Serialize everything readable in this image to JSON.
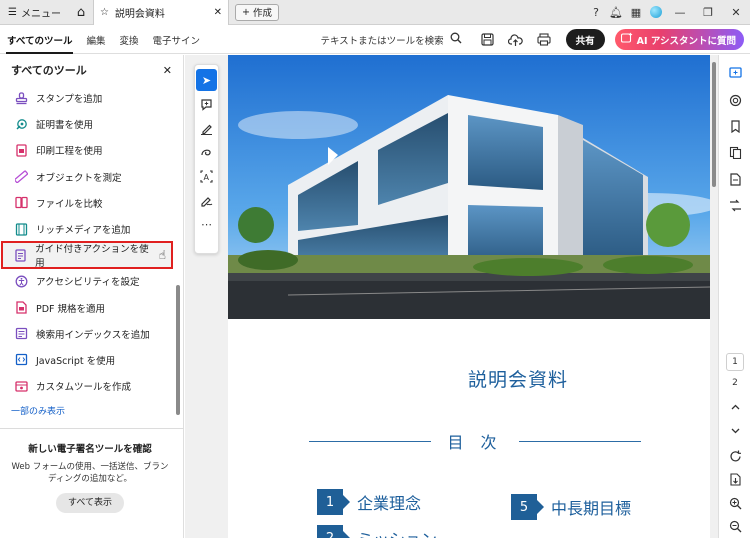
{
  "titlebar": {
    "menu_label": "メニュー",
    "tab_title": "説明会資料",
    "create_label": "作成"
  },
  "toolbar": {
    "tabs": [
      "すべてのツール",
      "編集",
      "変換",
      "電子サイン"
    ],
    "search_label": "テキストまたはツールを検索",
    "share_label": "共有",
    "ai_label": "AI アシスタントに質問"
  },
  "left_panel": {
    "title": "すべてのツール",
    "items": [
      {
        "label": "スタンプを追加",
        "icon": "stamp-icon",
        "color": "#7b4fbf"
      },
      {
        "label": "証明書を使用",
        "icon": "certificate-icon",
        "color": "#138c8c"
      },
      {
        "label": "印刷工程を使用",
        "icon": "print-production-icon",
        "color": "#d6306b"
      },
      {
        "label": "オブジェクトを測定",
        "icon": "ruler-icon",
        "color": "#b64fd6"
      },
      {
        "label": "ファイルを比較",
        "icon": "compare-icon",
        "color": "#d6306b"
      },
      {
        "label": "リッチメディアを追加",
        "icon": "film-icon",
        "color": "#138c8c"
      },
      {
        "label": "ガイド付きアクションを使用",
        "icon": "guided-action-icon",
        "color": "#7b4fbf"
      },
      {
        "label": "アクセシビリティを設定",
        "icon": "accessibility-icon",
        "color": "#7b4fbf"
      },
      {
        "label": "PDF 規格を適用",
        "icon": "pdf-standard-icon",
        "color": "#d6306b"
      },
      {
        "label": "検索用インデックスを追加",
        "icon": "index-icon",
        "color": "#7b4fbf"
      },
      {
        "label": "JavaScript を使用",
        "icon": "javascript-icon",
        "color": "#1460c8"
      },
      {
        "label": "カスタムツールを作成",
        "icon": "custom-tool-icon",
        "color": "#d6306b"
      }
    ],
    "show_less": "一部のみ表示",
    "promo_title": "新しい電子署名ツールを確認",
    "promo_desc": "Web フォームの使用、一括送信、ブランディングの追加など。",
    "promo_button": "すべて表示"
  },
  "document": {
    "title": "説明会資料",
    "toc_heading": "目 次",
    "toc_items": [
      {
        "num": "1",
        "text": "企業理念"
      },
      {
        "num": "5",
        "text": "中長期目標"
      },
      {
        "num": "2",
        "text": "ミッション"
      }
    ]
  },
  "page_indicator": {
    "current": "1",
    "total": "2"
  },
  "colors": {
    "accent_blue": "#1473e6",
    "doc_blue": "#1d5f9c",
    "highlight_red": "#e0201f"
  }
}
